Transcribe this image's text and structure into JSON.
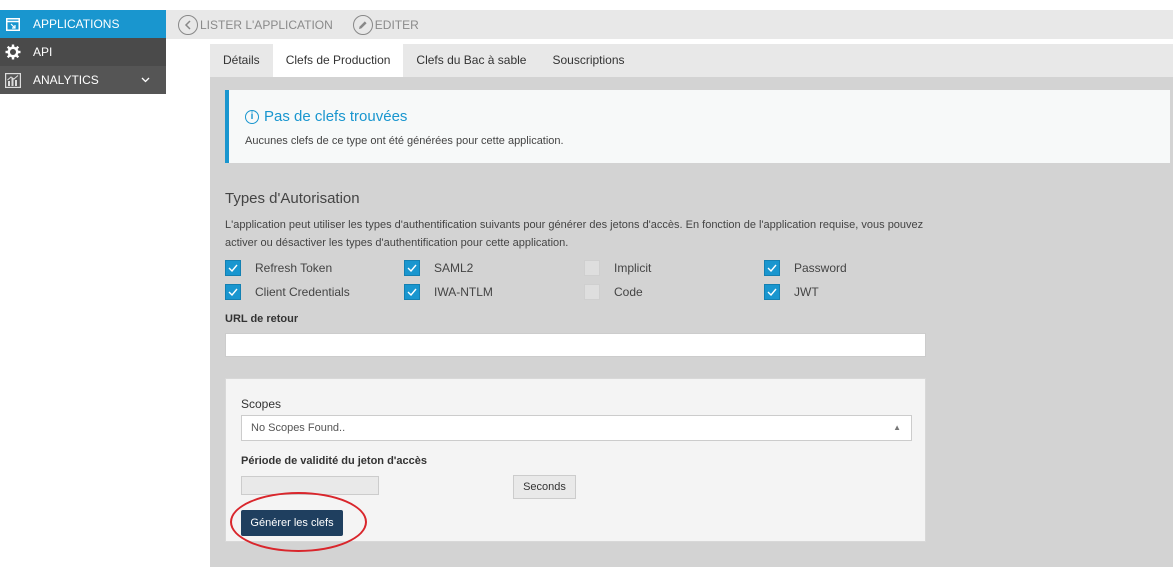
{
  "sidebar": {
    "items": [
      {
        "label": "APPLICATIONS",
        "icon": "applications-icon"
      },
      {
        "label": "API",
        "icon": "api-gear-icon"
      },
      {
        "label": "ANALYTICS",
        "icon": "analytics-chart-icon"
      }
    ]
  },
  "toolbar": {
    "list_label": "LISTER L'APPLICATION",
    "edit_label": "EDITER"
  },
  "tabs": [
    {
      "label": "Détails"
    },
    {
      "label": "Clefs de Production"
    },
    {
      "label": "Clefs du Bac à sable"
    },
    {
      "label": "Souscriptions"
    }
  ],
  "alert": {
    "title": "Pas de clefs trouvées",
    "text": "Aucunes clefs de ce type ont été générées pour cette application."
  },
  "auth": {
    "title": "Types d'Autorisation",
    "description": "L'application peut utiliser les types d'authentification suivants pour générer des jetons d'accès. En fonction de l'application requise, vous pouvez activer ou désactiver les types d'authentification pour cette application.",
    "types": [
      {
        "label": "Refresh Token",
        "checked": true
      },
      {
        "label": "SAML2",
        "checked": true
      },
      {
        "label": "Implicit",
        "checked": false
      },
      {
        "label": "Password",
        "checked": true
      },
      {
        "label": "Client Credentials",
        "checked": true
      },
      {
        "label": "IWA-NTLM",
        "checked": true
      },
      {
        "label": "Code",
        "checked": false
      },
      {
        "label": "JWT",
        "checked": true
      }
    ]
  },
  "callback": {
    "label": "URL de retour",
    "value": ""
  },
  "scopes": {
    "label": "Scopes",
    "placeholder": "No Scopes Found.."
  },
  "validity": {
    "label": "Période de validité du jeton d'accès",
    "value": "",
    "unit_label": "Seconds"
  },
  "generate_label": "Générer les clefs",
  "colors": {
    "accent": "#1996cf",
    "button_dark": "#1f3f5f",
    "highlight_ellipse": "#d9262c"
  }
}
